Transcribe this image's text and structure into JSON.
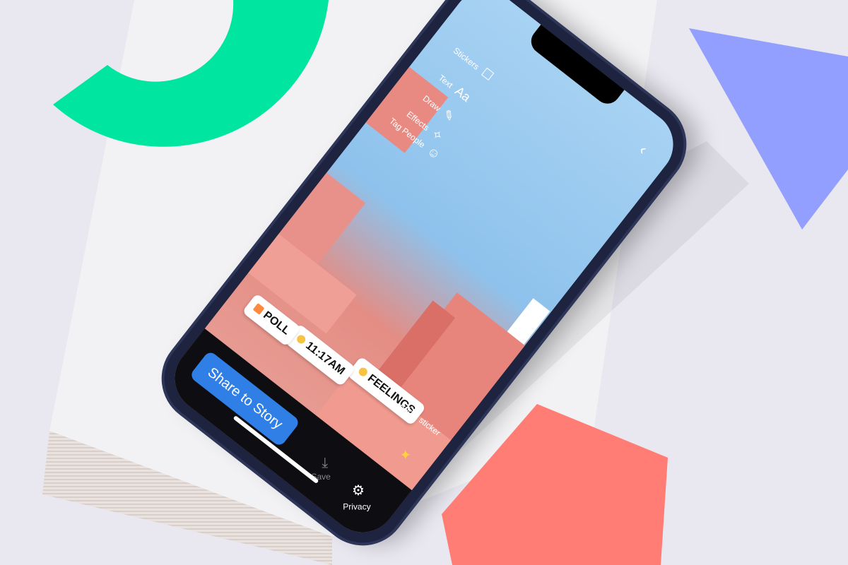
{
  "decor": {
    "ring_color": "#00e5a0",
    "triangle_color": "#929fff",
    "pentagon_color": "#ff7d75"
  },
  "editor": {
    "back_label": "‹",
    "tools": [
      {
        "label": "Stickers",
        "icon": "sticker-icon"
      },
      {
        "label": "Text",
        "icon": "text-aa-icon"
      },
      {
        "label": "Draw",
        "icon": "draw-icon"
      },
      {
        "label": "Effects",
        "icon": "effects-icon"
      },
      {
        "label": "Tag People",
        "icon": "tag-people-icon"
      }
    ],
    "text_glyph": "Aa",
    "hint": "Add a sticker",
    "stickers": [
      "FEELINGS",
      "11:17AM",
      "POLL"
    ],
    "bottom": {
      "privacy_label": "Privacy",
      "save_label": "Save",
      "share_label": "Share to Story"
    },
    "accent": "#2f7fe6"
  }
}
